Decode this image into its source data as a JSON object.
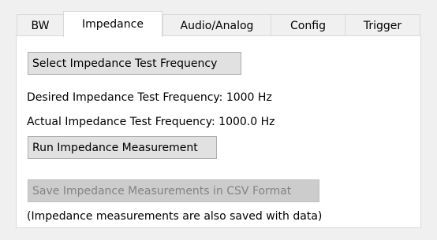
{
  "tabs": [
    {
      "label": "BW"
    },
    {
      "label": "Impedance"
    },
    {
      "label": "Audio/Analog"
    },
    {
      "label": "Config"
    },
    {
      "label": "Trigger"
    }
  ],
  "active_tab": "Impedance",
  "impedance": {
    "select_frequency_button": "Select Impedance Test Frequency",
    "desired_frequency_text": "Desired Impedance Test Frequency: 1000 Hz",
    "actual_frequency_text": "Actual Impedance Test Frequency: 1000.0 Hz",
    "run_measurement_button": "Run Impedance Measurement",
    "save_csv_button": "Save Impedance Measurements in CSV Format",
    "save_csv_enabled": false,
    "note_text": "(Impedance measurements are also saved with data)"
  }
}
